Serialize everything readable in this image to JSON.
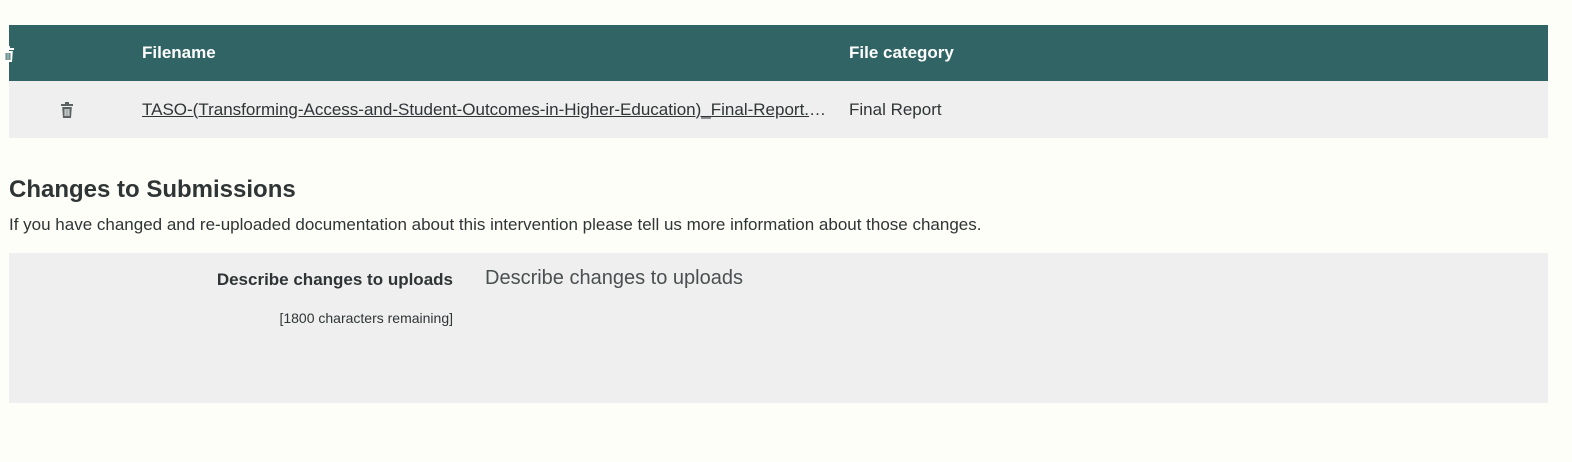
{
  "files_table": {
    "headers": {
      "filename": "Filename",
      "category": "File category"
    },
    "rows": [
      {
        "filename": "TASO-(Transforming-Access-and-Student-Outcomes-in-Higher-Education)_Final-Report.pdf",
        "category": "Final Report"
      }
    ],
    "icon": "trash-icon",
    "header_color": "#316464"
  },
  "changes_section": {
    "title": "Changes to Submissions",
    "description": "If you have changed and re-uploaded documentation about this intervention please tell us more information about those changes.",
    "field": {
      "label": "Describe changes to uploads",
      "placeholder": "Describe changes to uploads",
      "value": "",
      "remaining": "[1800 characters remaining]"
    }
  }
}
